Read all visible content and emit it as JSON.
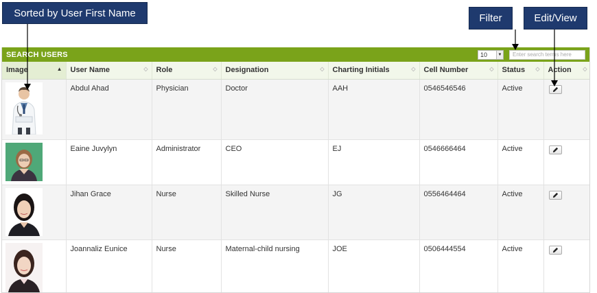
{
  "callouts": {
    "sort": "Sorted by User First Name",
    "filter": "Filter",
    "edit": "Edit/View"
  },
  "panel": {
    "title": "SEARCH USERS",
    "page_size": "10",
    "search_placeholder": "Enter search terms here"
  },
  "columns": [
    "Image",
    "User Name",
    "Role",
    "Designation",
    "Charting Initials",
    "Cell Number",
    "Status",
    "Action"
  ],
  "rows": [
    {
      "name": "Abdul Ahad",
      "role": "Physician",
      "designation": "Doctor",
      "initials": "AAH",
      "cell": "0546546546",
      "status": "Active",
      "avatar": "doctor-photo"
    },
    {
      "name": "Eaine Juvylyn",
      "role": "Administrator",
      "designation": "CEO",
      "initials": "EJ",
      "cell": "0546666464",
      "status": "Active",
      "avatar": "woman-green-background-photo"
    },
    {
      "name": "Jihan Grace",
      "role": "Nurse",
      "designation": "Skilled Nurse",
      "initials": "JG",
      "cell": "0556464464",
      "status": "Active",
      "avatar": "woman-white-background-photo"
    },
    {
      "name": "Joannaliz Eunice",
      "role": "Nurse",
      "designation": "Maternal-child nursing",
      "initials": "JOE",
      "cell": "0506444554",
      "status": "Active",
      "avatar": "woman-white-background-photo"
    }
  ],
  "colors": {
    "header_green": "#7aa31a",
    "callout_navy": "#1f3a6e"
  }
}
